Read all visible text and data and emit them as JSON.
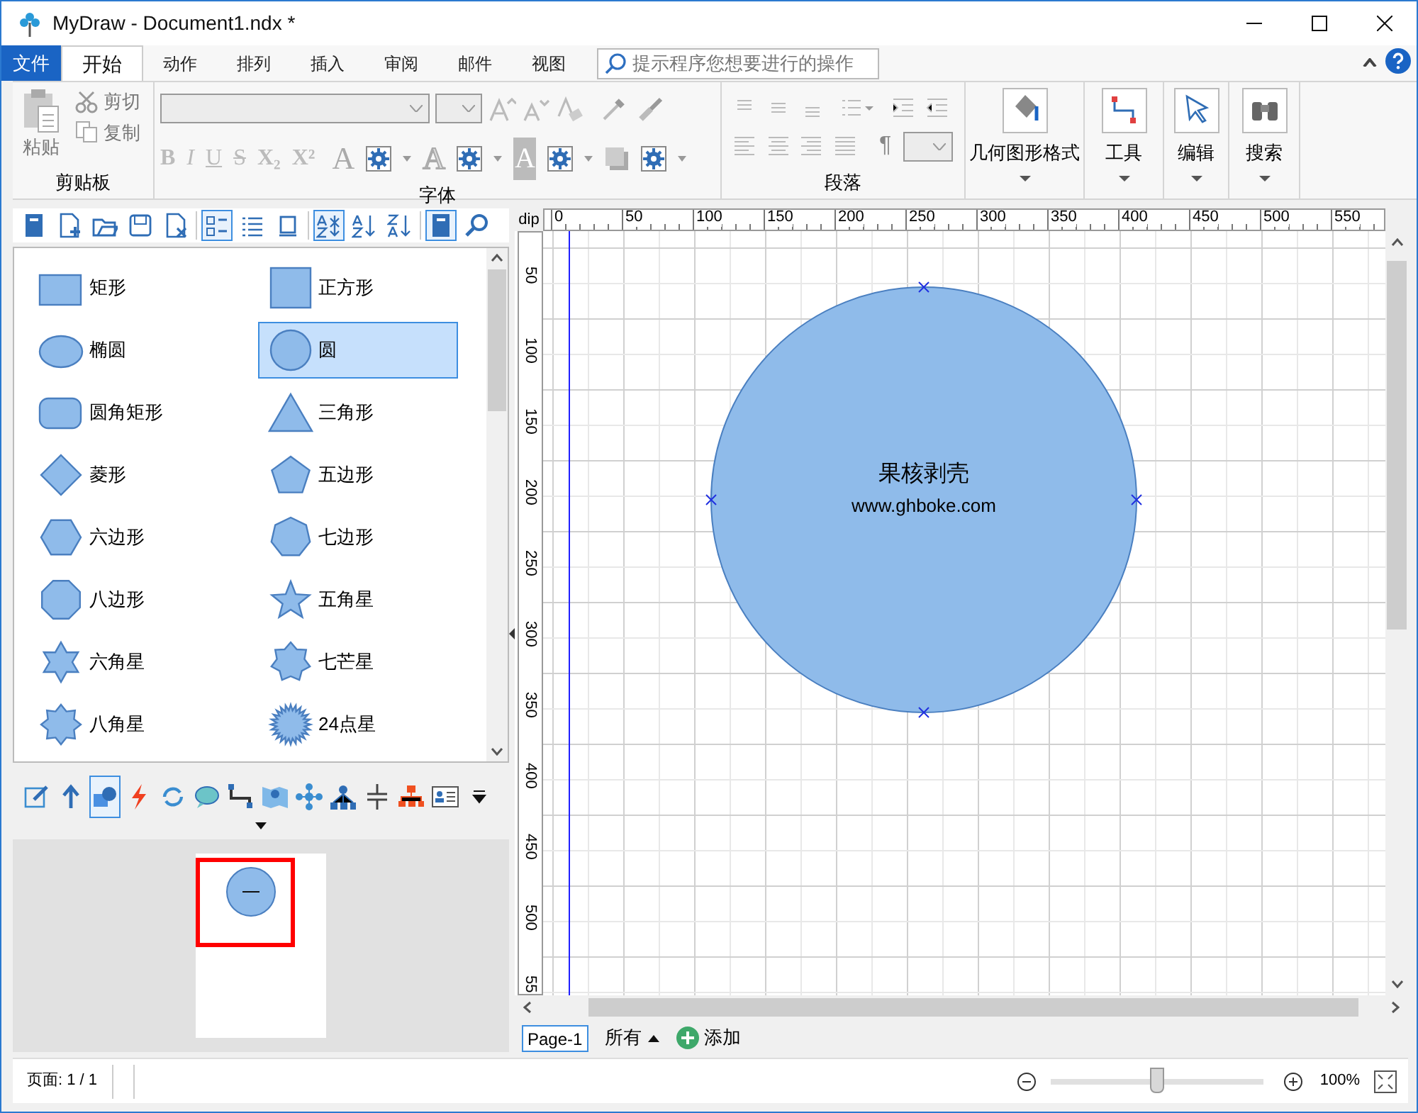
{
  "window": {
    "title": "MyDraw - Document1.ndx *"
  },
  "file_tab": "文件",
  "tabs": [
    {
      "label": "开始",
      "selected": true
    },
    {
      "label": "动作",
      "selected": false
    },
    {
      "label": "排列",
      "selected": false
    },
    {
      "label": "插入",
      "selected": false
    },
    {
      "label": "审阅",
      "selected": false
    },
    {
      "label": "邮件",
      "selected": false
    },
    {
      "label": "视图",
      "selected": false
    }
  ],
  "search": {
    "placeholder": "提示程序您想要进行的操作"
  },
  "ribbon": {
    "clipboard": {
      "paste": "粘贴",
      "cut": "剪切",
      "copy": "复制",
      "label": "剪贴板"
    },
    "font": {
      "format_buttons": [
        "B",
        "I",
        "U",
        "S",
        "X₂",
        "X²"
      ],
      "effect_letters": [
        "A",
        "A",
        "A"
      ],
      "label": "字体"
    },
    "paragraph": {
      "pilcrow": "¶",
      "label": "段落"
    },
    "big_buttons": [
      {
        "label": "几何图形格式",
        "kind": "fill"
      },
      {
        "label": "工具",
        "kind": "connector"
      },
      {
        "label": "编辑",
        "kind": "pointer"
      },
      {
        "label": "搜索",
        "kind": "binoculars"
      }
    ]
  },
  "shapes_toolbar": [
    {
      "kind": "book",
      "selected": false
    },
    {
      "kind": "new",
      "selected": false
    },
    {
      "kind": "open",
      "selected": false
    },
    {
      "kind": "save",
      "selected": false
    },
    {
      "kind": "close",
      "selected": false
    },
    {
      "kind": "grid",
      "selected": true
    },
    {
      "kind": "list",
      "selected": false
    },
    {
      "kind": "single",
      "selected": false
    },
    {
      "kind": "sort-toggle",
      "selected": true
    },
    {
      "kind": "sort-az",
      "selected": false
    },
    {
      "kind": "sort-za",
      "selected": false
    },
    {
      "kind": "book",
      "selected": true
    },
    {
      "kind": "search",
      "selected": false
    }
  ],
  "shapes": [
    {
      "label": "矩形",
      "kind": "rect",
      "selected": false
    },
    {
      "label": "正方形",
      "kind": "square",
      "selected": false
    },
    {
      "label": "椭圆",
      "kind": "ellipse",
      "selected": false
    },
    {
      "label": "圆",
      "kind": "circle",
      "selected": true
    },
    {
      "label": "圆角矩形",
      "kind": "roundrect",
      "selected": false
    },
    {
      "label": "三角形",
      "kind": "triangle",
      "selected": false
    },
    {
      "label": "菱形",
      "kind": "diamond",
      "selected": false
    },
    {
      "label": "五边形",
      "kind": "pentagon",
      "selected": false
    },
    {
      "label": "六边形",
      "kind": "hexagon",
      "selected": false
    },
    {
      "label": "七边形",
      "kind": "heptagon",
      "selected": false
    },
    {
      "label": "八边形",
      "kind": "octagon",
      "selected": false
    },
    {
      "label": "五角星",
      "kind": "star5",
      "selected": false
    },
    {
      "label": "六角星",
      "kind": "star6",
      "selected": false
    },
    {
      "label": "七芒星",
      "kind": "star7",
      "selected": false
    },
    {
      "label": "八角星",
      "kind": "star8",
      "selected": false
    },
    {
      "label": "24点星",
      "kind": "star24",
      "selected": false
    }
  ],
  "tools_toolbar": [
    {
      "kind": "pen",
      "selected": false
    },
    {
      "kind": "arrow",
      "selected": false
    },
    {
      "kind": "shapes",
      "selected": true
    },
    {
      "kind": "bolt",
      "selected": false
    },
    {
      "kind": "cycle",
      "selected": false
    },
    {
      "kind": "speech",
      "selected": false
    },
    {
      "kind": "connector",
      "selected": false
    },
    {
      "kind": "map",
      "selected": false
    },
    {
      "kind": "network",
      "selected": false
    },
    {
      "kind": "hierarchy",
      "selected": false
    },
    {
      "kind": "capacitor",
      "selected": false
    },
    {
      "kind": "org",
      "selected": false
    },
    {
      "kind": "card",
      "selected": false
    },
    {
      "kind": "more",
      "selected": false
    }
  ],
  "ruler": {
    "unit": "dip",
    "x_labels": [
      "0",
      "50",
      "100",
      "150",
      "200",
      "250",
      "300",
      "350",
      "400",
      "450",
      "500",
      "550"
    ],
    "y_labels": [
      "50",
      "100",
      "150",
      "200",
      "250",
      "300",
      "350",
      "400",
      "450",
      "500",
      "55"
    ]
  },
  "canvas": {
    "shape": {
      "kind": "circle",
      "lines": [
        "果核剥壳",
        "www.ghboke.com"
      ],
      "selected": true
    }
  },
  "page_tabs": [
    {
      "label": "Page-1",
      "selected": true
    }
  ],
  "page_filter": "所有",
  "add_page": "添加",
  "status_bar": {
    "page": "页面: 1 / 1",
    "zoom": {
      "level": 0.5,
      "reading": "100%"
    }
  }
}
